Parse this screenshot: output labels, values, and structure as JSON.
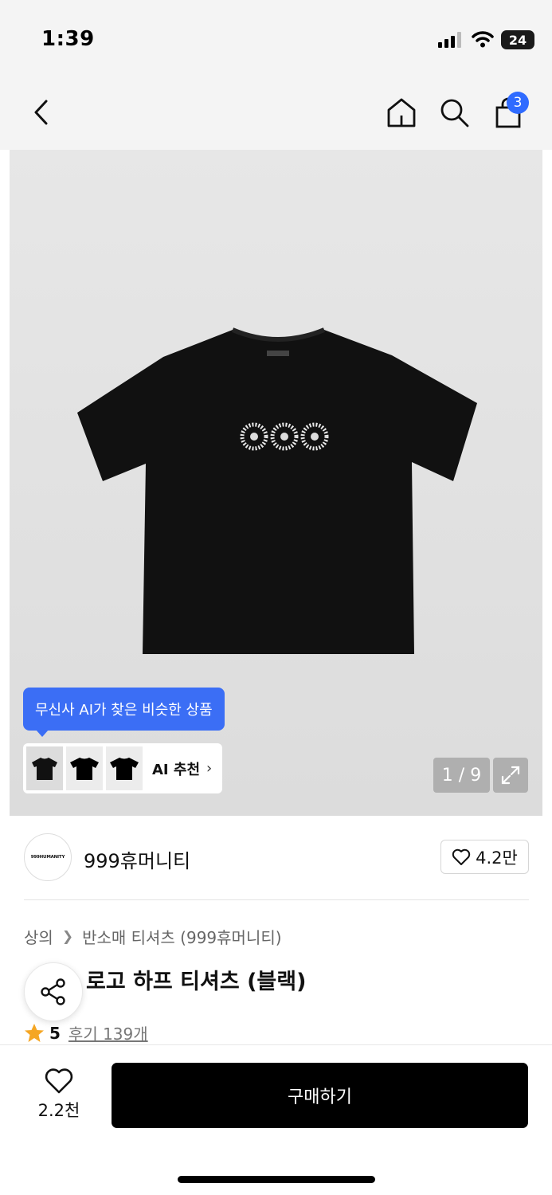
{
  "status": {
    "time": "1:39",
    "battery": "24"
  },
  "nav": {
    "cart_count": "3"
  },
  "gallery": {
    "ai_tooltip": "무신사 AI가 찾은 비슷한 상품",
    "ai_label": "AI 추천",
    "page_counter": "1 / 9"
  },
  "brand": {
    "logo_text": "999HUMANITY",
    "name": "999휴머니티",
    "likes": "4.2만"
  },
  "breadcrumb": [
    "상의",
    "반소매 티셔츠 (999휴머니티)"
  ],
  "product": {
    "title_visible": "로고 하프 티셔츠 (블랙)",
    "rating": "5",
    "reviews": "후기 139개"
  },
  "bottom": {
    "wish_count": "2.2천",
    "buy_label": "구매하기"
  },
  "colors": {
    "accent_blue": "#3b6ef5",
    "star": "#f5a623",
    "buy_button": "#000000"
  },
  "icons": [
    "back-icon",
    "home-icon",
    "search-icon",
    "bag-icon",
    "expand-icon",
    "heart-icon",
    "share-icon",
    "star-icon"
  ]
}
